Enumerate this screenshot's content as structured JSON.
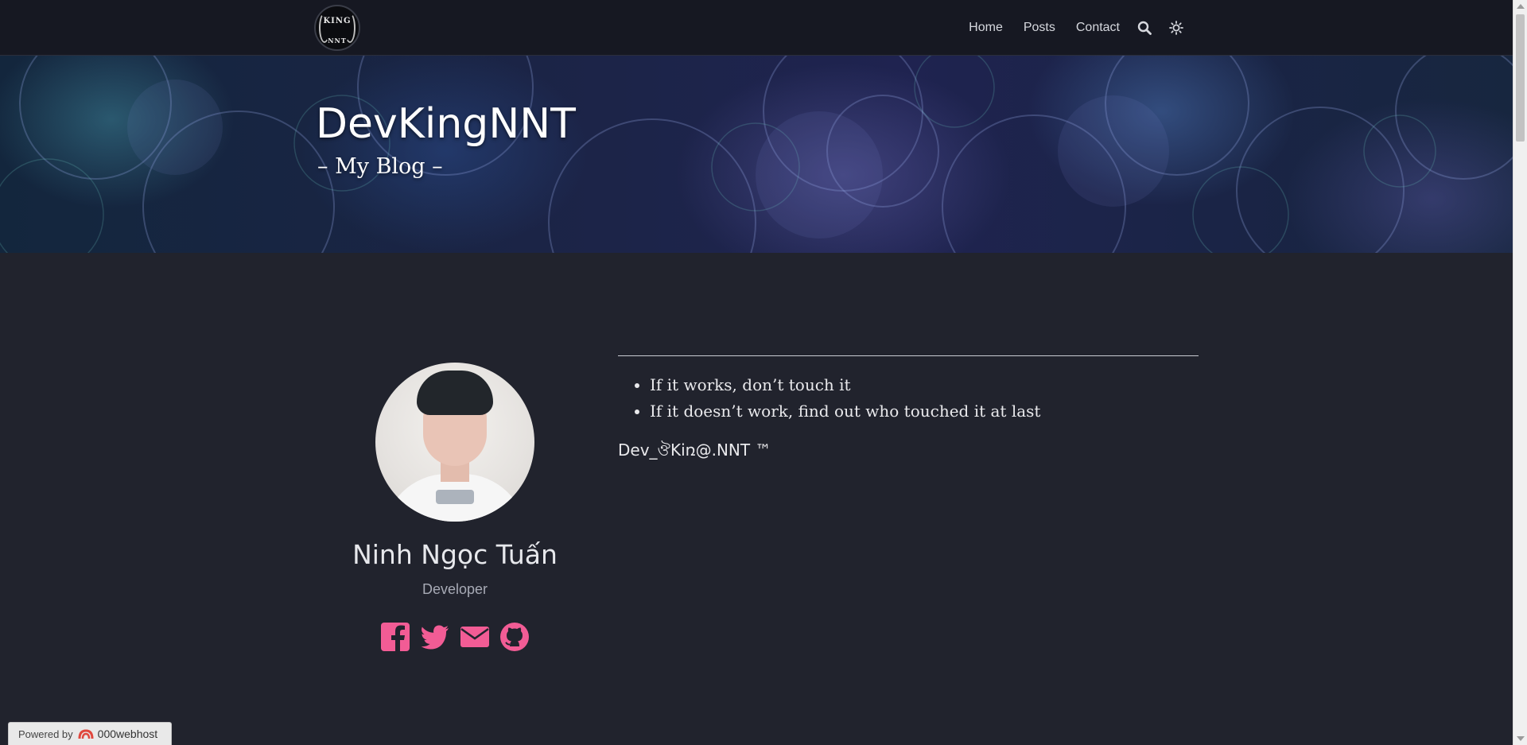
{
  "navbar": {
    "logo": {
      "top_text": "KING",
      "bottom_text": "NNT",
      "icon": "king-nnt-logo"
    },
    "links": [
      {
        "label": "Home"
      },
      {
        "label": "Posts"
      },
      {
        "label": "Contact"
      }
    ],
    "search_icon": "search-icon",
    "theme_icon": "sun-icon"
  },
  "hero": {
    "title": "DevKingNNT",
    "subtitle": "– My Blog –"
  },
  "profile": {
    "name": "Ninh Ngọc Tuấn",
    "role": "Developer",
    "social": [
      {
        "icon": "facebook-icon"
      },
      {
        "icon": "twitter-icon"
      },
      {
        "icon": "email-icon"
      },
      {
        "icon": "github-icon"
      }
    ],
    "accent_color": "#f25c95"
  },
  "content": {
    "mottos": [
      "If it works, don’t touch it",
      "If it doesn’t work, find out who touched it at last"
    ],
    "signature": "Dev_ঔKiռ@.NNT ™"
  },
  "badge": {
    "label": "Powered by",
    "brand": "000webhost"
  }
}
